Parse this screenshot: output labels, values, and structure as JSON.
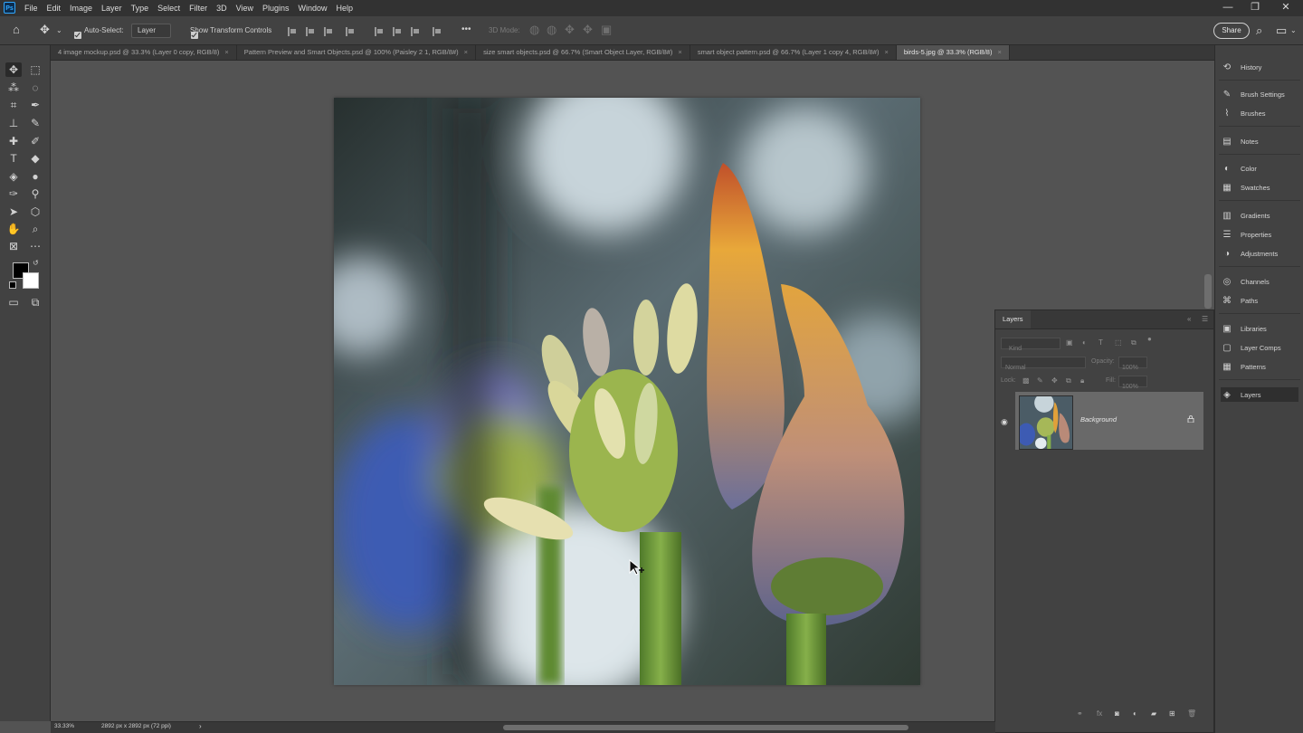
{
  "app": {
    "logo_text": "Ps"
  },
  "menu": [
    "File",
    "Edit",
    "Image",
    "Layer",
    "Type",
    "Select",
    "Filter",
    "3D",
    "View",
    "Plugins",
    "Window",
    "Help"
  ],
  "window_controls": {
    "minimize": "—",
    "restore": "❐",
    "close": "✕"
  },
  "options_bar": {
    "auto_select_label": "Auto-Select:",
    "auto_select_target": "Layer",
    "show_transform_label": "Show Transform Controls",
    "mode_3d_label": "3D Mode:",
    "more": "•••",
    "share_label": "Share"
  },
  "tabs": [
    {
      "title": "4 image mockup.psd @ 33.3% (Layer 0 copy, RGB/8)",
      "active": false
    },
    {
      "title": "Pattern Preview and Smart Objects.psd @ 100% (Paisley 2 1, RGB/8#)",
      "active": false
    },
    {
      "title": "size smart objects.psd @ 66.7% (Smart Object Layer, RGB/8#)",
      "active": false
    },
    {
      "title": "smart object pattern.psd @ 66.7% (Layer 1 copy 4, RGB/8#)",
      "active": false
    },
    {
      "title": "birds-5.jpg @ 33.3% (RGB/8)",
      "active": true
    }
  ],
  "colors": {
    "foreground": "#000000",
    "background": "#ffffff"
  },
  "right_panels": [
    {
      "icon": "history-icon",
      "glyph": "⟲",
      "label": "History"
    },
    {
      "icon": "brush-settings-icon",
      "glyph": "✎",
      "label": "Brush Settings"
    },
    {
      "icon": "brushes-icon",
      "glyph": "⌇",
      "label": "Brushes"
    },
    {
      "icon": "notes-icon",
      "glyph": "▤",
      "label": "Notes"
    },
    {
      "icon": "color-icon",
      "glyph": "◐",
      "label": "Color"
    },
    {
      "icon": "swatches-icon",
      "glyph": "▦",
      "label": "Swatches"
    },
    {
      "icon": "gradients-icon",
      "glyph": "▥",
      "label": "Gradients"
    },
    {
      "icon": "properties-icon",
      "glyph": "☰",
      "label": "Properties"
    },
    {
      "icon": "adjustments-icon",
      "glyph": "◑",
      "label": "Adjustments"
    },
    {
      "icon": "channels-icon",
      "glyph": "◎",
      "label": "Channels"
    },
    {
      "icon": "paths-icon",
      "glyph": "⌘",
      "label": "Paths"
    },
    {
      "icon": "libraries-icon",
      "glyph": "▣",
      "label": "Libraries"
    },
    {
      "icon": "layer-comps-icon",
      "glyph": "▢",
      "label": "Layer Comps"
    },
    {
      "icon": "patterns-icon",
      "glyph": "▦",
      "label": "Patterns"
    },
    {
      "icon": "layers-icon",
      "glyph": "◈",
      "label": "Layers"
    }
  ],
  "layers_panel": {
    "title": "Layers",
    "filter_kind": "Kind",
    "blend_mode": "Normal",
    "opacity_label": "Opacity:",
    "opacity_value": "100%",
    "lock_label": "Lock:",
    "fill_label": "Fill:",
    "fill_value": "100%",
    "layer_name": "Background"
  },
  "status": {
    "zoom": "33.33%",
    "doc_info": "2892 px x 2892 px (72 ppi)",
    "arrow": "›"
  }
}
